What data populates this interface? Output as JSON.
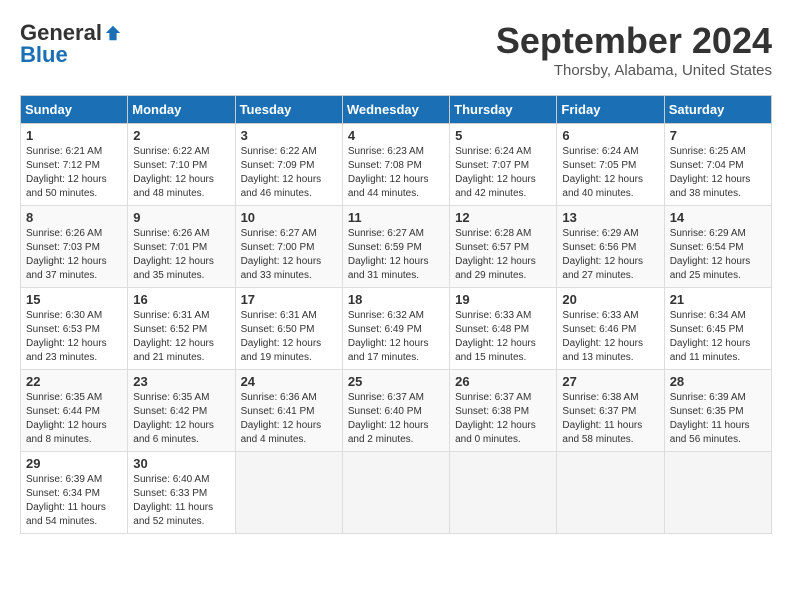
{
  "header": {
    "logo_general": "General",
    "logo_blue": "Blue",
    "month_title": "September 2024",
    "location": "Thorsby, Alabama, United States"
  },
  "calendar": {
    "days_of_week": [
      "Sunday",
      "Monday",
      "Tuesday",
      "Wednesday",
      "Thursday",
      "Friday",
      "Saturday"
    ],
    "weeks": [
      [
        {
          "day": "1",
          "sunrise": "6:21 AM",
          "sunset": "7:12 PM",
          "daylight": "12 hours and 50 minutes."
        },
        {
          "day": "2",
          "sunrise": "6:22 AM",
          "sunset": "7:10 PM",
          "daylight": "12 hours and 48 minutes."
        },
        {
          "day": "3",
          "sunrise": "6:22 AM",
          "sunset": "7:09 PM",
          "daylight": "12 hours and 46 minutes."
        },
        {
          "day": "4",
          "sunrise": "6:23 AM",
          "sunset": "7:08 PM",
          "daylight": "12 hours and 44 minutes."
        },
        {
          "day": "5",
          "sunrise": "6:24 AM",
          "sunset": "7:07 PM",
          "daylight": "12 hours and 42 minutes."
        },
        {
          "day": "6",
          "sunrise": "6:24 AM",
          "sunset": "7:05 PM",
          "daylight": "12 hours and 40 minutes."
        },
        {
          "day": "7",
          "sunrise": "6:25 AM",
          "sunset": "7:04 PM",
          "daylight": "12 hours and 38 minutes."
        }
      ],
      [
        {
          "day": "8",
          "sunrise": "6:26 AM",
          "sunset": "7:03 PM",
          "daylight": "12 hours and 37 minutes."
        },
        {
          "day": "9",
          "sunrise": "6:26 AM",
          "sunset": "7:01 PM",
          "daylight": "12 hours and 35 minutes."
        },
        {
          "day": "10",
          "sunrise": "6:27 AM",
          "sunset": "7:00 PM",
          "daylight": "12 hours and 33 minutes."
        },
        {
          "day": "11",
          "sunrise": "6:27 AM",
          "sunset": "6:59 PM",
          "daylight": "12 hours and 31 minutes."
        },
        {
          "day": "12",
          "sunrise": "6:28 AM",
          "sunset": "6:57 PM",
          "daylight": "12 hours and 29 minutes."
        },
        {
          "day": "13",
          "sunrise": "6:29 AM",
          "sunset": "6:56 PM",
          "daylight": "12 hours and 27 minutes."
        },
        {
          "day": "14",
          "sunrise": "6:29 AM",
          "sunset": "6:54 PM",
          "daylight": "12 hours and 25 minutes."
        }
      ],
      [
        {
          "day": "15",
          "sunrise": "6:30 AM",
          "sunset": "6:53 PM",
          "daylight": "12 hours and 23 minutes."
        },
        {
          "day": "16",
          "sunrise": "6:31 AM",
          "sunset": "6:52 PM",
          "daylight": "12 hours and 21 minutes."
        },
        {
          "day": "17",
          "sunrise": "6:31 AM",
          "sunset": "6:50 PM",
          "daylight": "12 hours and 19 minutes."
        },
        {
          "day": "18",
          "sunrise": "6:32 AM",
          "sunset": "6:49 PM",
          "daylight": "12 hours and 17 minutes."
        },
        {
          "day": "19",
          "sunrise": "6:33 AM",
          "sunset": "6:48 PM",
          "daylight": "12 hours and 15 minutes."
        },
        {
          "day": "20",
          "sunrise": "6:33 AM",
          "sunset": "6:46 PM",
          "daylight": "12 hours and 13 minutes."
        },
        {
          "day": "21",
          "sunrise": "6:34 AM",
          "sunset": "6:45 PM",
          "daylight": "12 hours and 11 minutes."
        }
      ],
      [
        {
          "day": "22",
          "sunrise": "6:35 AM",
          "sunset": "6:44 PM",
          "daylight": "12 hours and 8 minutes."
        },
        {
          "day": "23",
          "sunrise": "6:35 AM",
          "sunset": "6:42 PM",
          "daylight": "12 hours and 6 minutes."
        },
        {
          "day": "24",
          "sunrise": "6:36 AM",
          "sunset": "6:41 PM",
          "daylight": "12 hours and 4 minutes."
        },
        {
          "day": "25",
          "sunrise": "6:37 AM",
          "sunset": "6:40 PM",
          "daylight": "12 hours and 2 minutes."
        },
        {
          "day": "26",
          "sunrise": "6:37 AM",
          "sunset": "6:38 PM",
          "daylight": "12 hours and 0 minutes."
        },
        {
          "day": "27",
          "sunrise": "6:38 AM",
          "sunset": "6:37 PM",
          "daylight": "11 hours and 58 minutes."
        },
        {
          "day": "28",
          "sunrise": "6:39 AM",
          "sunset": "6:35 PM",
          "daylight": "11 hours and 56 minutes."
        }
      ],
      [
        {
          "day": "29",
          "sunrise": "6:39 AM",
          "sunset": "6:34 PM",
          "daylight": "11 hours and 54 minutes."
        },
        {
          "day": "30",
          "sunrise": "6:40 AM",
          "sunset": "6:33 PM",
          "daylight": "11 hours and 52 minutes."
        },
        null,
        null,
        null,
        null,
        null
      ]
    ]
  }
}
